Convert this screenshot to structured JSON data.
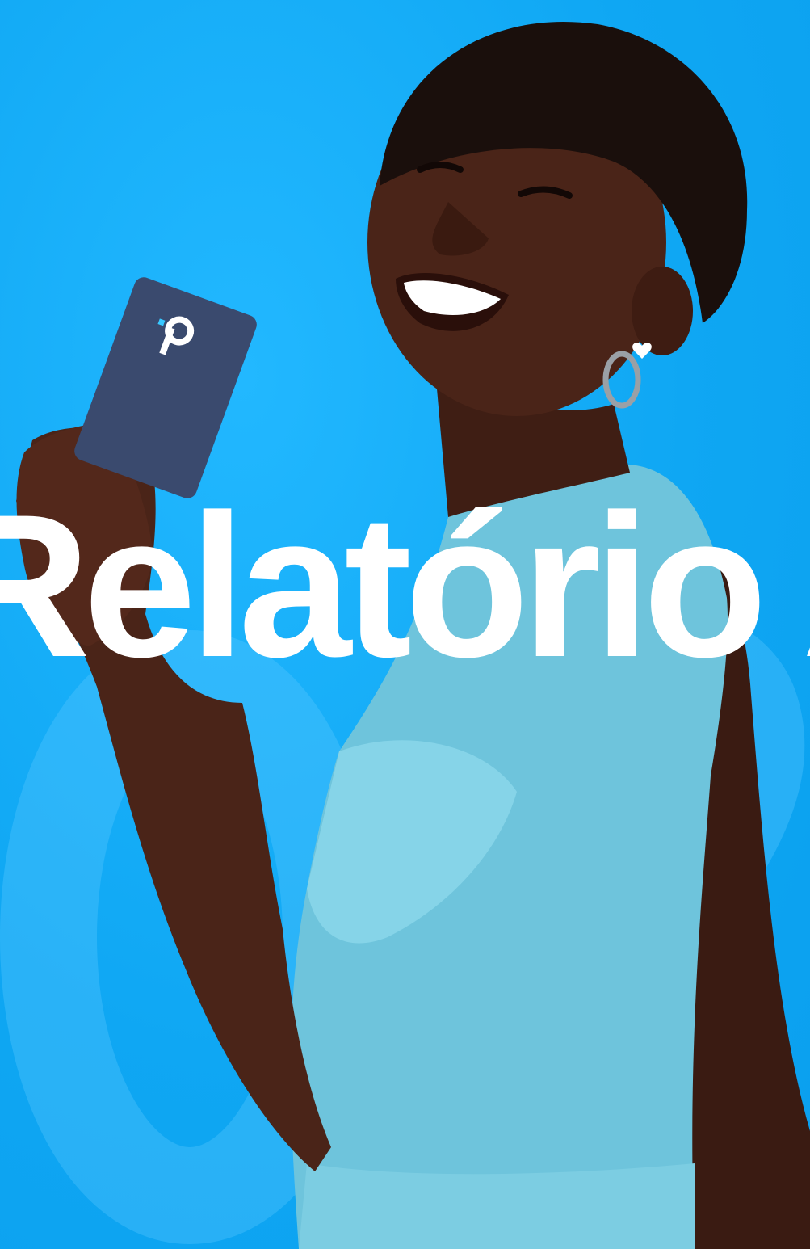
{
  "colors": {
    "background": "#13aef9",
    "headline": "#ffffff",
    "card": "#3a4a6e",
    "card_logo": "#ffffff",
    "card_dot": "#38c8ff",
    "top": "#6fc6dd",
    "skin": "#4a2418",
    "hair": "#1a0f0c"
  },
  "hero": {
    "headline": "Relatório Anual"
  },
  "card": {
    "logo_letter": "P",
    "icon": "card-logo-icon"
  },
  "watermark": {
    "icon": "year-watermark-icon"
  }
}
